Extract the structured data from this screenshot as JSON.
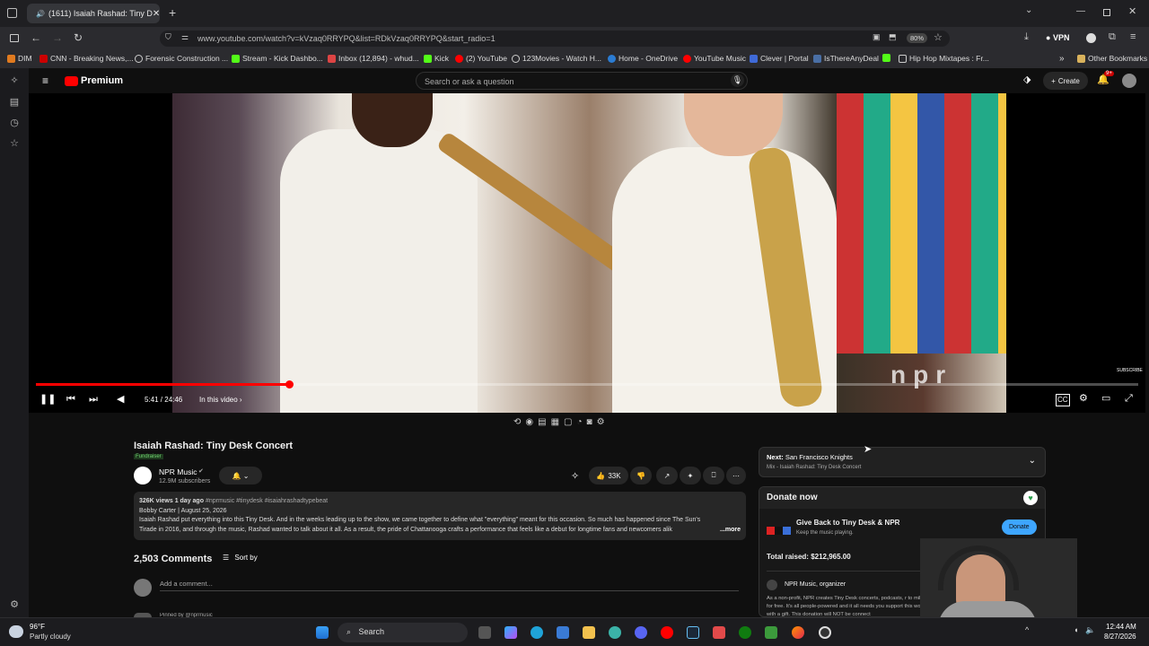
{
  "browser": {
    "tab_title": "(1611) Isaiah Rashad: Tiny D",
    "url": "www.youtube.com/watch?v=kVzaq0RRYPQ&list=RDkVzaq0RRYPQ&start_radio=1",
    "zoom": "80%",
    "vpn": "VPN",
    "bookmarks": [
      "DIM",
      "CNN - Breaking News,...",
      "Forensic Construction ...",
      "Stream - Kick Dashbo...",
      "Inbox (12,894) - whud...",
      "Kick",
      "(2) YouTube",
      "123Movies - Watch H...",
      "Home - OneDrive",
      "YouTube Music",
      "Clever | Portal",
      "IsThereAnyDeal",
      "Hip Hop Mixtapes : Fr..."
    ],
    "other_bookmarks": "Other Bookmarks"
  },
  "yt": {
    "logo": "Premium",
    "search_placeholder": "Search or ask a question",
    "create": "Create",
    "notif_badge": "9+"
  },
  "player": {
    "time": "5:41 / 24:46",
    "chapter": "In this video",
    "progress": 0.23,
    "subscribe_watermark": "SUBSCRIBE",
    "npr_watermark": "npr"
  },
  "video": {
    "title": "Isaiah Rashad: Tiny Desk Concert",
    "badge": "Fundraiser",
    "channel": "NPR Music",
    "subscribers": "12.9M subscribers",
    "likes": "33K",
    "meta": "326K views  1 day ago",
    "tags": "#nprmusic #tinydesk #isaiahrashadtypebeat",
    "desc_line1": "Bobby Carter | August 25, 2026",
    "desc_line2": "Isaiah Rashad put everything into this Tiny Desk. And in the weeks leading up to the show, we came together to define what \"everything\" meant for this occasion. So much has happened since The Sun's",
    "desc_line3": "Tirade in 2016, and through the music, Rashad wanted to talk about it all. As a result, the pride of Chattanooga crafts a performance that feels like a debut for longtime fans and newcomers alik",
    "more": "...more",
    "comments_count": "2,503 Comments",
    "sort_by": "Sort by",
    "add_comment": "Add a comment...",
    "pinned": "Pinned by @nprmusic"
  },
  "next": {
    "label": "Next:",
    "title": "San Francisco Knights",
    "sub": "Mix - Isaiah Rashad: Tiny Desk Concert"
  },
  "donate": {
    "header": "Donate now",
    "title": "Give Back to Tiny Desk & NPR",
    "sub": "Keep the music playing.",
    "button": "Donate",
    "total": "Total raised: $212,965.00",
    "organizer": "NPR Music, organizer",
    "body": "As a non-profit, NPR creates Tiny Desk concerts, podcasts, r to millions for free. It's all people-powered and it all needs you support this work with a gift. This donation will NOT be connect"
  },
  "taskbar": {
    "temp": "96°F",
    "weather": "Partly cloudy",
    "search": "Search",
    "time": "12:44 AM",
    "date": "8/27/2026"
  }
}
